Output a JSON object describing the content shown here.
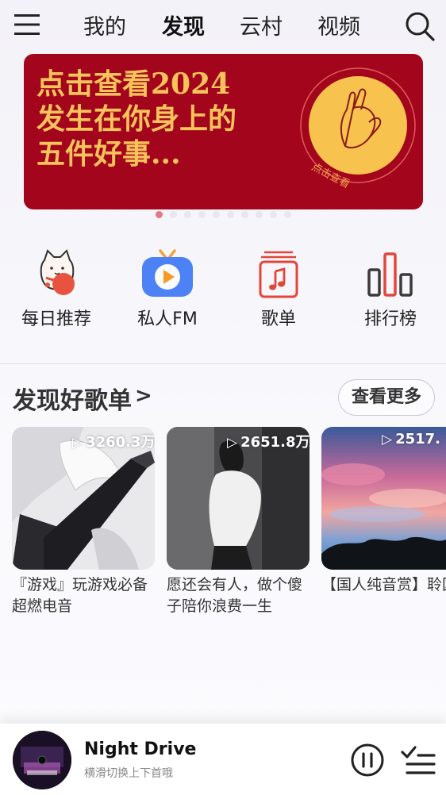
{
  "header": {
    "tabs": [
      {
        "label": "我的",
        "active": false
      },
      {
        "label": "发现",
        "active": true
      },
      {
        "label": "云村",
        "active": false
      },
      {
        "label": "视频",
        "active": false
      }
    ],
    "menu_icon": "hamburger-menu-icon",
    "search_icon": "search-icon"
  },
  "banner": {
    "line1": "点击查看2024",
    "line2": "发生在你身上的",
    "line3": "五件好事...",
    "seal_text": "点击查看",
    "background": "#a3061c",
    "text_color": "#f7c35b",
    "dot_count": 10,
    "active_dot": 0
  },
  "quick_links": [
    {
      "label": "每日推荐",
      "icon": "lucky-cat-icon"
    },
    {
      "label": "私人FM",
      "icon": "tv-fm-icon"
    },
    {
      "label": "歌单",
      "icon": "playlist-sheet-icon"
    },
    {
      "label": "排行榜",
      "icon": "chart-bars-icon"
    }
  ],
  "section": {
    "title": "发现好歌单",
    "arrow": ">",
    "more_label": "查看更多"
  },
  "playlists": [
    {
      "play_count": "3260.3万",
      "title": "『游戏』玩游戏必备超燃电音"
    },
    {
      "play_count": "2651.8万",
      "title": "愿还会有人，做个傻子陪你浪费一生"
    },
    {
      "play_count": "2517.",
      "title": "【国人纯音赏】聆国人华章"
    }
  ],
  "player": {
    "song_title": "Night Drive",
    "subtitle": "横滑切换上下首哦",
    "pause_icon": "pause-icon",
    "playlist_icon": "playlist-icon"
  }
}
